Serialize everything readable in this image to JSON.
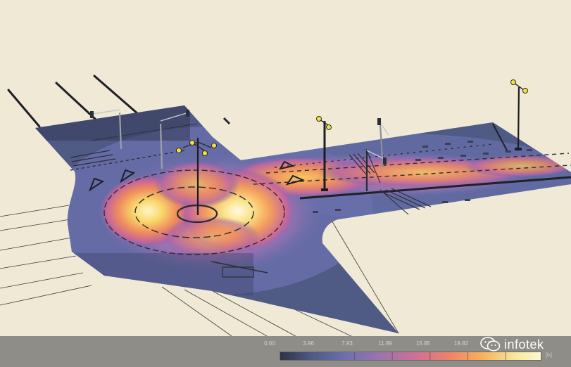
{
  "legend": {
    "ticks": [
      "0.00",
      "3.96",
      "7.93",
      "11.89",
      "15.85",
      "19.82"
    ],
    "unit": "[lx]",
    "gradient": [
      "#2f3348",
      "#4d5a86",
      "#6d6fae",
      "#9a74b0",
      "#cf6f97",
      "#ee8268",
      "#f7b25d",
      "#f9e69a",
      "#fff8d0"
    ]
  },
  "brand": {
    "name": "infotek",
    "icon": "wechat-icon"
  },
  "colors": {
    "background": "#efe9d6",
    "bar": "#8f8d88",
    "lamp": "#f3e43a"
  }
}
